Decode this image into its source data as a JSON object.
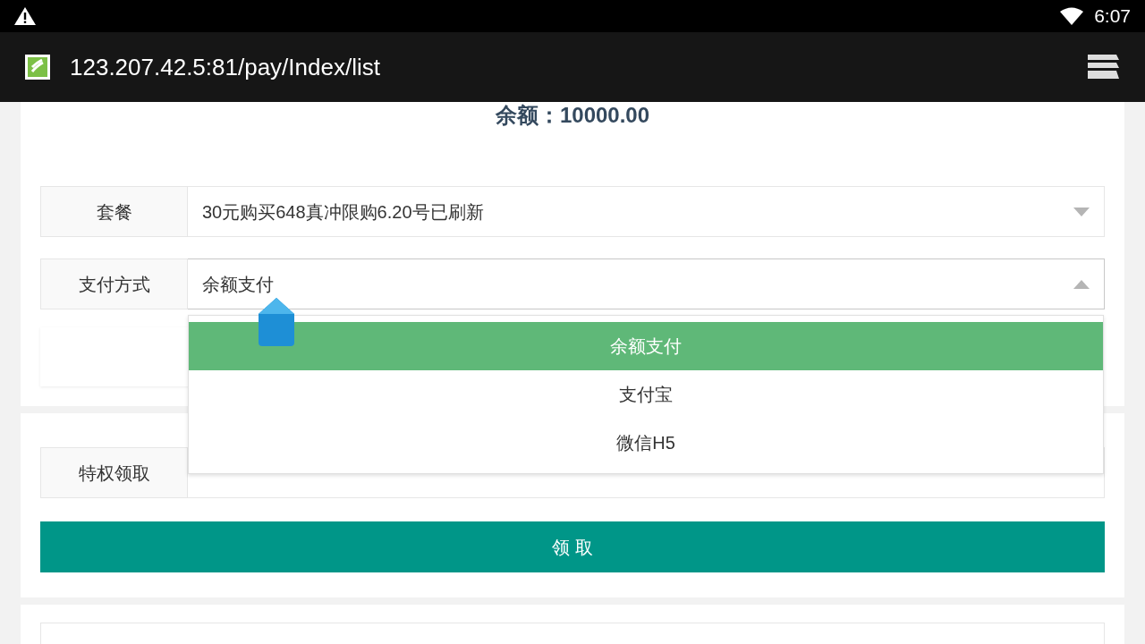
{
  "status_bar": {
    "time": "6:07"
  },
  "browser": {
    "url": "123.207.42.5:81/pay/Index/list"
  },
  "balance": {
    "label": "余额：",
    "value": "10000.00"
  },
  "form": [
    {
      "label": "套餐",
      "value": "30元购买648真冲限购6.20号已刷新",
      "expanded": false
    },
    {
      "label": "支付方式",
      "value": "余额支付",
      "expanded": true
    }
  ],
  "dropdown": [
    {
      "label": "余额支付",
      "selected": true
    },
    {
      "label": "支付宝",
      "selected": false
    },
    {
      "label": "微信H5",
      "selected": false
    }
  ],
  "privilege": {
    "label": "特权领取"
  },
  "submit_button": "领 取"
}
